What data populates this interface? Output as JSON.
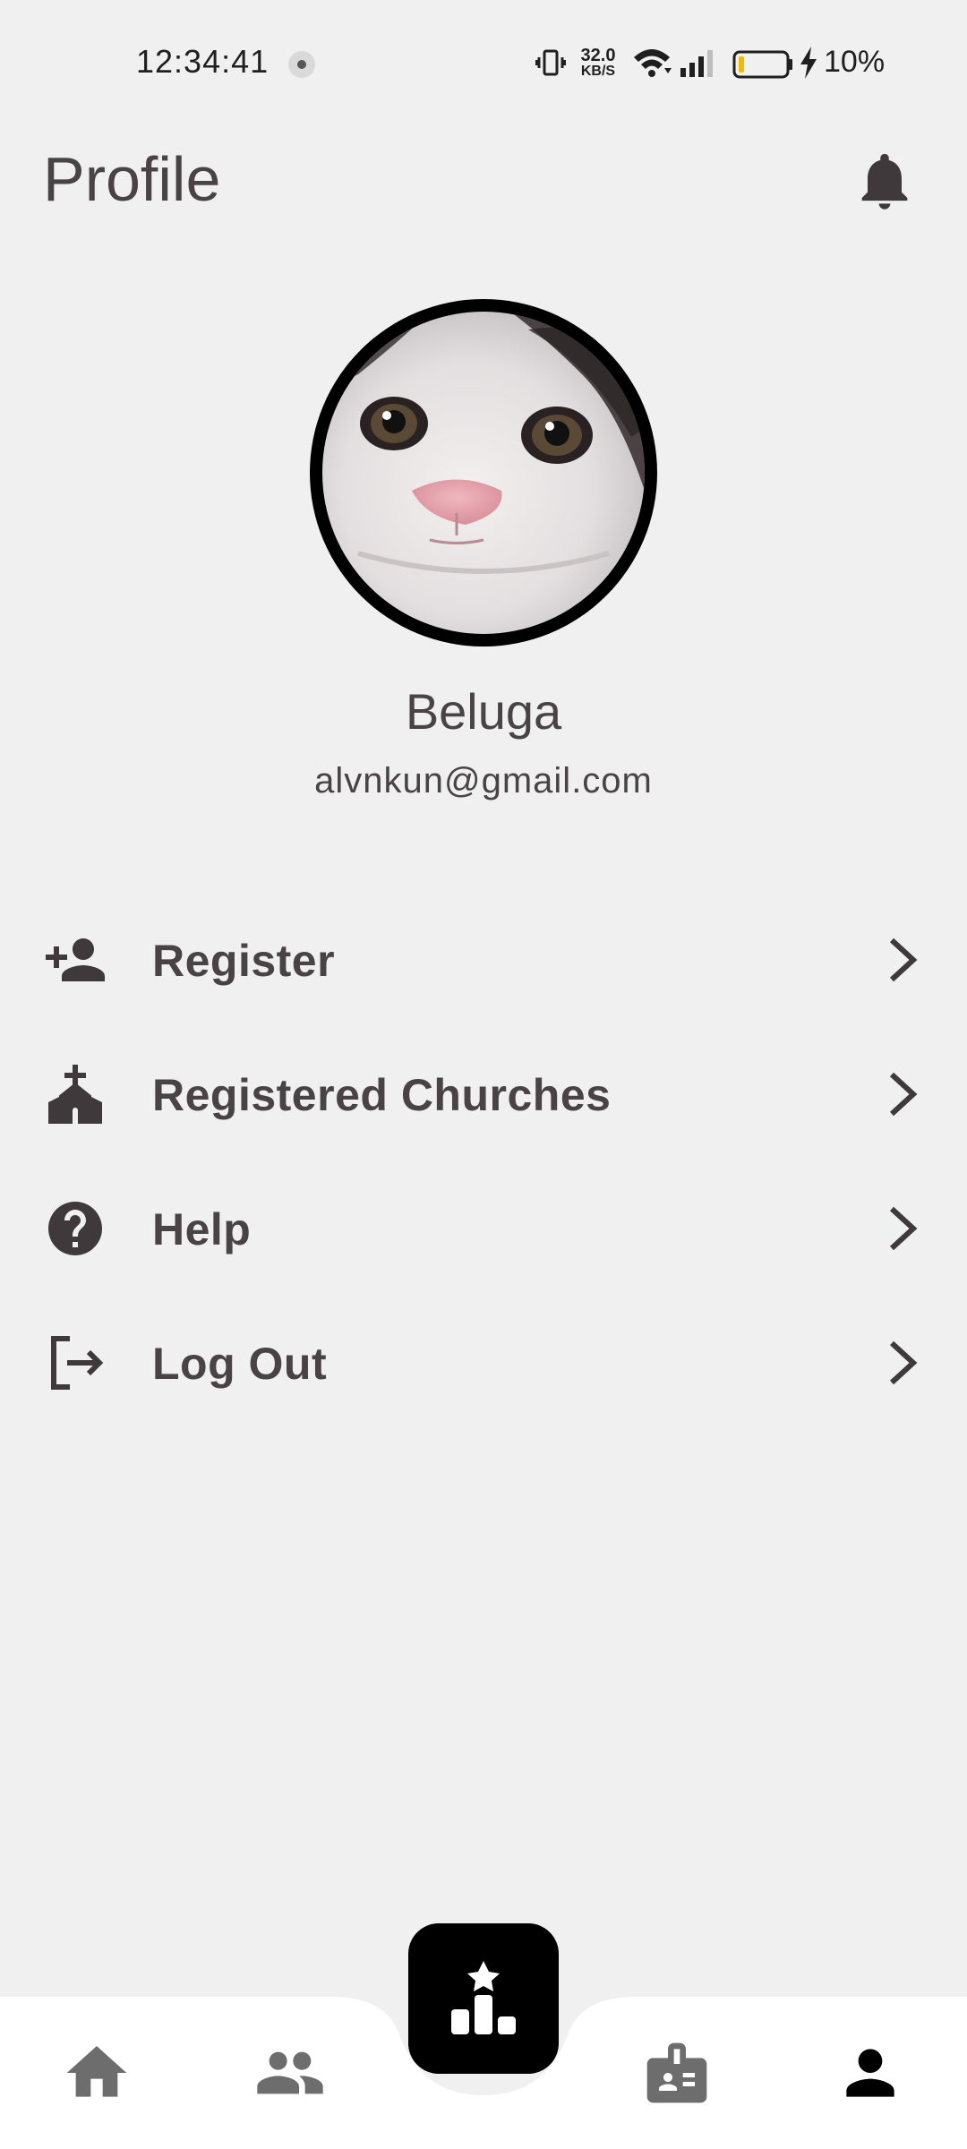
{
  "status_bar": {
    "time": "12:34:41",
    "net_speed_value": "32.0",
    "net_speed_unit": "KB/S",
    "battery_percent": "10%"
  },
  "header": {
    "title": "Profile"
  },
  "profile": {
    "name": "Beluga",
    "email": "alvnkun@gmail.com"
  },
  "menu": {
    "items": [
      {
        "label": "Register",
        "icon": "person-add-icon"
      },
      {
        "label": "Registered Churches",
        "icon": "church-icon"
      },
      {
        "label": "Help",
        "icon": "help-icon"
      },
      {
        "label": "Log Out",
        "icon": "logout-icon"
      }
    ]
  },
  "bottom_nav": {
    "items": [
      "home-icon",
      "group-icon",
      "leaderboard-icon",
      "badge-icon",
      "person-icon"
    ],
    "active": "person-icon"
  },
  "colors": {
    "background": "#f0f0f0",
    "text": "#4a4345",
    "nav_inactive": "#6d6d6d",
    "nav_active": "#000000"
  }
}
